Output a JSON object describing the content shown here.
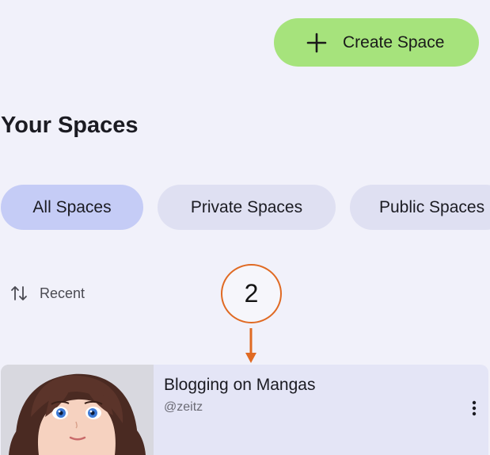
{
  "header": {
    "create_label": "Create Space"
  },
  "page_title": "Your Spaces",
  "filters": [
    {
      "label": "All Spaces",
      "active": true
    },
    {
      "label": "Private Spaces",
      "active": false
    },
    {
      "label": "Public Spaces",
      "active": false
    }
  ],
  "sort": {
    "label": "Recent"
  },
  "annotation": {
    "step": "2"
  },
  "space_card": {
    "title": "Blogging on Mangas",
    "author": "@zeitz"
  },
  "colors": {
    "background": "#f1f1fa",
    "create_button": "#a6e37c",
    "pill_active": "#c5ccf6",
    "pill_inactive": "#dfe0f2",
    "card": "#e4e5f6",
    "annotation": "#e06a23"
  },
  "icons": {
    "create": "plus-icon",
    "sort": "sort-arrows-icon",
    "card_menu": "more-vertical-icon"
  }
}
